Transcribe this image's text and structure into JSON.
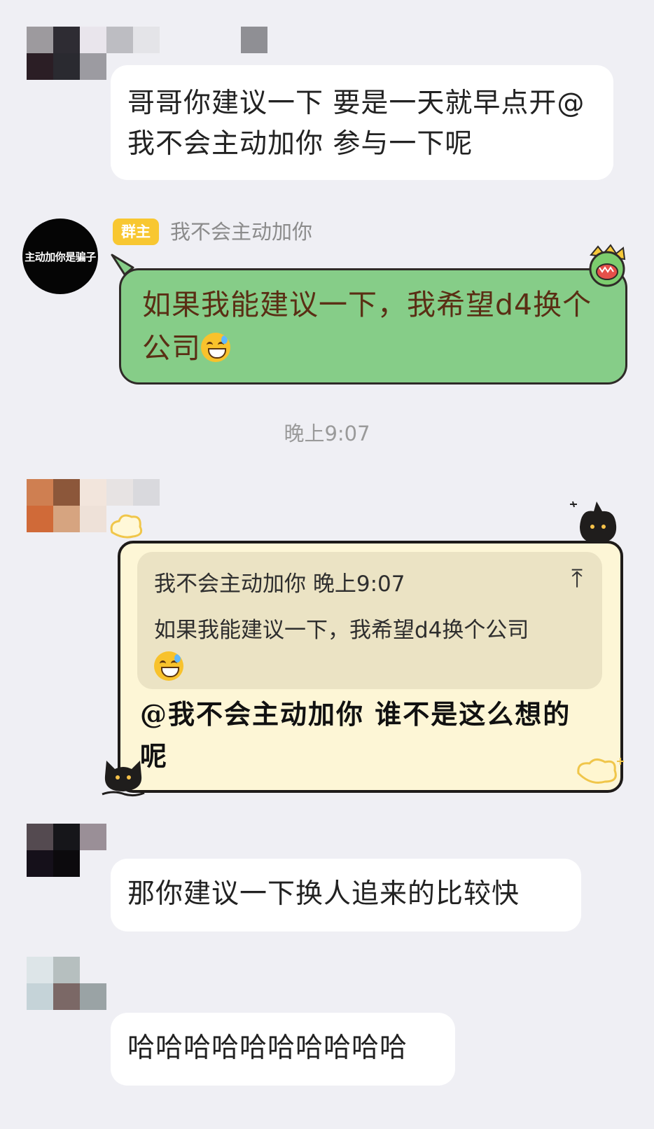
{
  "messages": {
    "m1": {
      "text": "哥哥你建议一下 要是一天就早点开@我不会主动加你 参与一下呢"
    },
    "m2": {
      "avatar_text": "主动加你是骗子",
      "badge": "群主",
      "sender": "我不会主动加你",
      "text": "如果我能建议一下，我希望d4换个公司",
      "emoji": "sweat-smile-emoji"
    },
    "timestamp": "晚上9:07",
    "m3": {
      "quote_sender": "我不会主动加你",
      "quote_time": "晚上9:07",
      "quote_text": "如果我能建议一下，我希望d4换个公司",
      "quote_arrow": "⤒",
      "text": "@我不会主动加你 谁不是这么想的呢"
    },
    "m4": {
      "text": "那你建议一下换人追来的比较快"
    },
    "m5": {
      "text": "哈哈哈哈哈哈哈哈哈哈"
    }
  },
  "colors": {
    "background": "#efeff4",
    "green_bubble": "#86cd88",
    "cream_bubble": "#fdf6d6",
    "badge": "#f8c731"
  }
}
